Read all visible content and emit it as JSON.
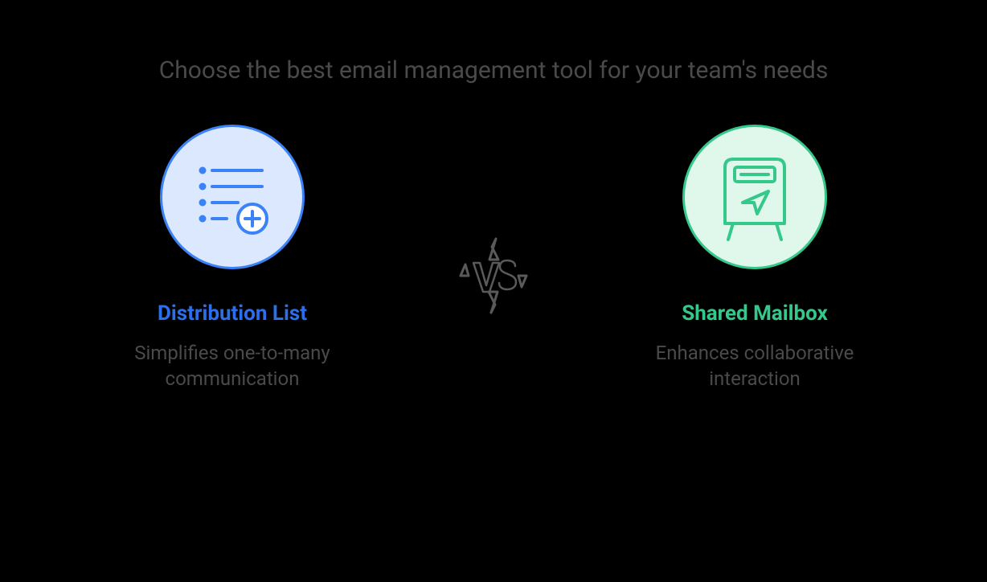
{
  "heading": "Choose the best email management tool for your team's needs",
  "left": {
    "title": "Distribution List",
    "desc": "Simplifies one-to-many communication"
  },
  "right": {
    "title": "Shared Mailbox",
    "desc": "Enhances collaborative interaction"
  },
  "vs": "VS",
  "colors": {
    "blue": "#2c6fed",
    "green": "#34c98a",
    "text": "#4a4a4a"
  }
}
